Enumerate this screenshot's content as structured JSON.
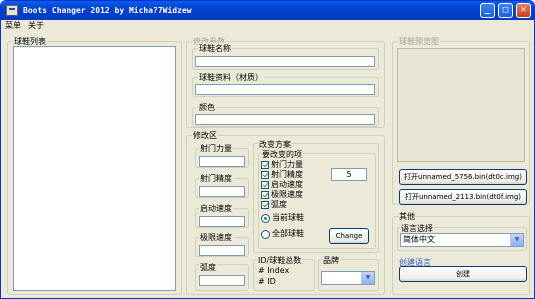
{
  "window": {
    "title": "Boots Changer 2012 by Micha?7Widzew",
    "min_label": "_",
    "max_label": "□",
    "close_label": "✕"
  },
  "menu": [
    "菜单",
    "关于"
  ],
  "boot_list": {
    "legend": "球鞋列表"
  },
  "edit_params": {
    "legend": "修改参数",
    "name_label": "球鞋名称",
    "material_label": "球鞋资料（材质）",
    "color_label": "颜色"
  },
  "edit_area": {
    "legend": "修改区",
    "fields": [
      "射门力量",
      "射门精度",
      "启动速度",
      "极限速度",
      "弧度"
    ],
    "plan": {
      "legend": "改变方案",
      "items_legend": "要改变的项",
      "checkboxes": [
        "射门力量",
        "射门精度",
        "启动速度",
        "极限速度",
        "弧度"
      ],
      "value": "5",
      "radios": [
        "当前球鞋",
        "全部球鞋"
      ],
      "change_label": "Change"
    },
    "id_group": {
      "legend": "ID/球鞋总数",
      "index_label": "# Index",
      "id_label": "# ID"
    },
    "brand": {
      "legend": "品牌",
      "value": "",
      "arrow": "▼"
    }
  },
  "preview": {
    "legend": "球鞋预览图",
    "open1_label": "打开unnamed_5756.bin(dt0c.img)",
    "open2_label": "打开unnamed_2113.bin(dt0f.img)"
  },
  "other": {
    "legend": "其他",
    "lang_legend": "语言选择",
    "lang_value": "简体中文",
    "arrow": "▼",
    "create_lang_link": "创建语言",
    "create_label": "创建"
  }
}
